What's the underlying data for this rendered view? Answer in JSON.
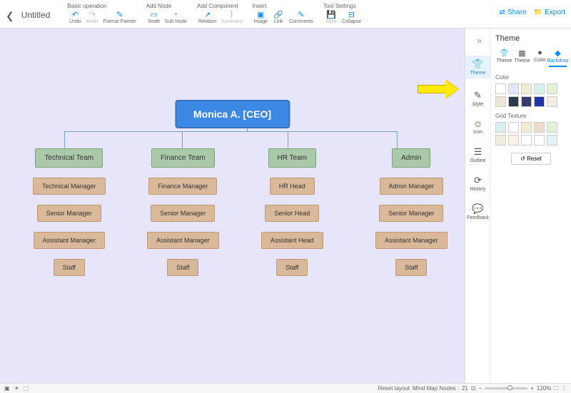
{
  "header": {
    "title": "Untitled",
    "groups": [
      {
        "label": "Basic operation",
        "items": [
          {
            "name": "undo",
            "label": "Undo",
            "icon": "↶",
            "cls": ""
          },
          {
            "name": "redo",
            "label": "Redo",
            "icon": "↷",
            "cls": "gray"
          },
          {
            "name": "format-painter",
            "label": "Format Painter",
            "icon": "✎",
            "cls": ""
          }
        ]
      },
      {
        "label": "Add Node",
        "items": [
          {
            "name": "node",
            "label": "Node",
            "icon": "▭",
            "cls": ""
          },
          {
            "name": "sub-node",
            "label": "Sub Node",
            "icon": "▫",
            "cls": ""
          }
        ]
      },
      {
        "label": "Add Component",
        "items": [
          {
            "name": "relation",
            "label": "Relation",
            "icon": "↗",
            "cls": ""
          },
          {
            "name": "summary",
            "label": "Summary",
            "icon": "}",
            "cls": "gray"
          }
        ]
      },
      {
        "label": "Insert",
        "items": [
          {
            "name": "image",
            "label": "Image",
            "icon": "▣",
            "cls": ""
          },
          {
            "name": "link",
            "label": "Link",
            "icon": "🔗",
            "cls": ""
          },
          {
            "name": "comments",
            "label": "Comments",
            "icon": "✎",
            "cls": ""
          }
        ]
      },
      {
        "label": "Tool Settings",
        "items": [
          {
            "name": "save",
            "label": "Save",
            "icon": "💾",
            "cls": "gray"
          },
          {
            "name": "collapse",
            "label": "Collapse",
            "icon": "⊟",
            "cls": ""
          }
        ]
      }
    ],
    "share": "Share",
    "export": "Export"
  },
  "chart_data": {
    "type": "org",
    "root": {
      "label": "Monica A. [CEO]"
    },
    "departments": [
      {
        "name": "Technical Team",
        "roles": [
          "Technical Manager",
          "Senior Manager",
          "Assistant Manager",
          "Staff"
        ]
      },
      {
        "name": "Finance Team",
        "roles": [
          "Finance Manager",
          "Senior Manager",
          "Assistant Manager",
          "Staff"
        ]
      },
      {
        "name": "HR Team",
        "roles": [
          "HR Head",
          "Senior Head",
          "Assistant Head",
          "Staff"
        ]
      },
      {
        "name": "Admin",
        "roles": [
          "Admin Manager",
          "Senior Manager",
          "Assistant Manager",
          "Staff"
        ]
      }
    ]
  },
  "sidebar": {
    "items": [
      {
        "name": "theme",
        "label": "Theme",
        "icon": "👕",
        "active": true
      },
      {
        "name": "style",
        "label": "Style",
        "icon": "✎"
      },
      {
        "name": "icon",
        "label": "Icon",
        "icon": "☺"
      },
      {
        "name": "outline",
        "label": "Outline",
        "icon": "☰"
      },
      {
        "name": "history",
        "label": "History",
        "icon": "⟳"
      },
      {
        "name": "feedback",
        "label": "Feedback",
        "icon": "💬"
      }
    ]
  },
  "panel": {
    "title": "Theme",
    "tabs": [
      {
        "name": "theme",
        "label": "Theme",
        "icon": "👕"
      },
      {
        "name": "theme2",
        "label": "Theme",
        "icon": "▦"
      },
      {
        "name": "color",
        "label": "Color",
        "icon": "●"
      },
      {
        "name": "backdrop",
        "label": "Backdrop",
        "icon": "◆",
        "active": true
      }
    ],
    "color_label": "Color",
    "colors": [
      "#ffffff",
      "#e6e5fa",
      "#f3ecd0",
      "#d8f0ee",
      "#e2f1d8",
      "#f0e6d8",
      "#2d3b4a",
      "#3a3a6a",
      "#2233aa",
      "#f3efe0"
    ],
    "grid_label": "Grid Texture",
    "grids": [
      "#d8f0ee",
      "#ffffff",
      "#f3ecd0",
      "#f0dccc",
      "#e2f1d8",
      "#f3efe0",
      "#f7f3e6",
      "#ffffff",
      "#ffffff",
      "#e6f2f5"
    ],
    "reset": "Reset"
  },
  "status": {
    "reset_layout": "Reset layout",
    "nodes_label": "Mind Map Nodes :",
    "nodes_count": "21",
    "zoom": "120%"
  }
}
